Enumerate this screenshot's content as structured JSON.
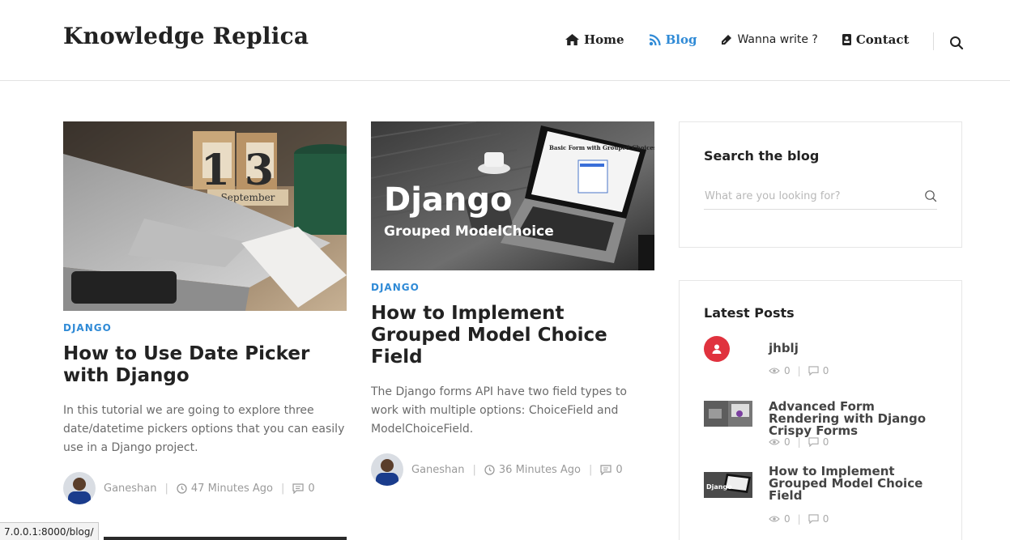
{
  "header": {
    "brand": "Knowledge Replica",
    "nav": [
      {
        "label": "Home",
        "icon": "home-icon",
        "active": false
      },
      {
        "label": "Blog",
        "icon": "rss-icon",
        "active": true
      },
      {
        "label": "Wanna write ?",
        "icon": "pen-icon",
        "active": false
      },
      {
        "label": "Contact",
        "icon": "contact-card-icon",
        "active": false
      }
    ],
    "search_icon": "search-icon"
  },
  "posts": [
    {
      "category": "DJANGO",
      "title": "How to Use Date Picker with Django",
      "excerpt": "In this tutorial we are going to explore three date/datetime pickers options that you can easily use in a Django project.",
      "author": "Ganeshan",
      "time": "47 Minutes Ago",
      "comments": "0",
      "image_text": {
        "day_1": "1",
        "day_2": "3",
        "month": "September"
      }
    },
    {
      "category": "DJANGO",
      "title": "How to Implement Grouped Model Choice Field",
      "excerpt": "The Django forms API have two field types to work with multiple options: ChoiceField and ModelChoiceField.",
      "author": "Ganeshan",
      "time": "36 Minutes Ago",
      "comments": "0",
      "image_text": {
        "headline": "Django",
        "subhead": "Grouped ModelChoice",
        "form_title": "Basic Form with Grouped Choices"
      }
    }
  ],
  "sidebar": {
    "search": {
      "title": "Search the blog",
      "placeholder": "What are you looking for?"
    },
    "latest": {
      "title": "Latest Posts",
      "items": [
        {
          "title": "jhblj",
          "views": "0",
          "comments": "0"
        },
        {
          "title": "Advanced Form Rendering with Django Crispy Forms",
          "views": "0",
          "comments": "0"
        },
        {
          "title": "How to Implement Grouped Model Choice Field",
          "views": "0",
          "comments": "0"
        }
      ]
    }
  },
  "statusbar": {
    "url": "7.0.0.1:8000/blog/"
  },
  "colors": {
    "accent": "#2f8ad6",
    "text": "#222222",
    "muted": "#6b6b6b",
    "avatar_red": "#e0323e"
  }
}
